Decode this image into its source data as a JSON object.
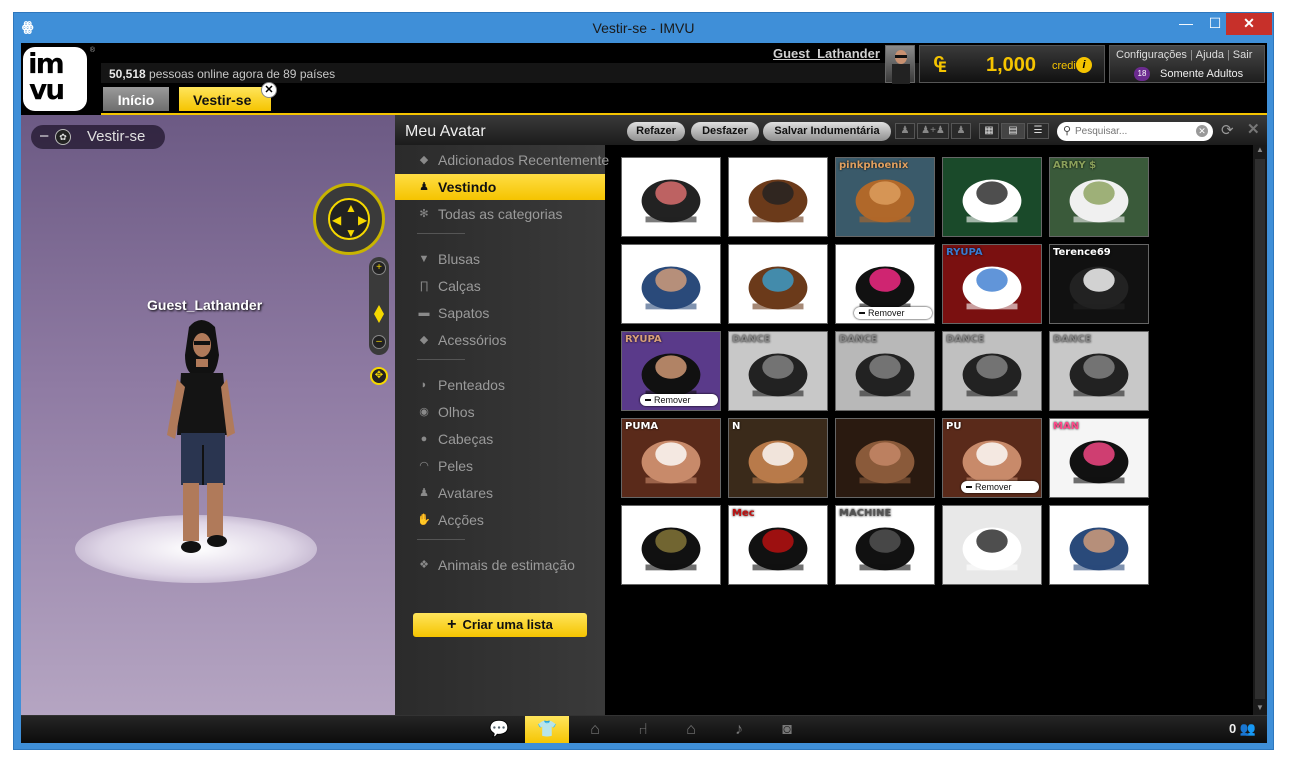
{
  "window": {
    "title": "Vestir-se - IMVU"
  },
  "header": {
    "online_count": "50,518",
    "online_text": " pessoas online agora de 89 países",
    "username": "Guest_Lathander",
    "credits_value": "1,000",
    "credits_label": "credits",
    "links": [
      "Configurações",
      "Ajuda",
      "Sair"
    ],
    "age_badge": "18",
    "age_filter": "Somente Adultos"
  },
  "tabs": [
    {
      "label": "Início"
    },
    {
      "label": "Vestir-se"
    }
  ],
  "viewport": {
    "tab_label": "Vestir-se",
    "avatar_name": "Guest_Lathander"
  },
  "panel": {
    "title": "Meu Avatar",
    "redo": "Refazer",
    "undo": "Desfazer",
    "save_outfit": "Salvar Indumentária",
    "search_placeholder": "Pesquisar..."
  },
  "sidebar": {
    "items": [
      {
        "label": "Adicionados Recentemente",
        "icon": "tag-icon"
      },
      {
        "label": "Vestindo",
        "icon": "person-icon"
      },
      {
        "label": "Todas as categorias",
        "icon": "asterisk-icon"
      },
      {
        "label": "Blusas",
        "icon": "shirt-icon"
      },
      {
        "label": "Calças",
        "icon": "pants-icon"
      },
      {
        "label": "Sapatos",
        "icon": "shoe-icon"
      },
      {
        "label": "Acessórios",
        "icon": "diamond-icon"
      },
      {
        "label": "Penteados",
        "icon": "hair-icon"
      },
      {
        "label": "Olhos",
        "icon": "eye-icon"
      },
      {
        "label": "Cabeças",
        "icon": "head-icon"
      },
      {
        "label": "Peles",
        "icon": "lips-icon"
      },
      {
        "label": "Avatares",
        "icon": "avatar-icon"
      },
      {
        "label": "Acções",
        "icon": "action-icon"
      },
      {
        "label": "Animais de estimação",
        "icon": "paw-icon"
      }
    ],
    "create_list": "Criar uma lista"
  },
  "grid": {
    "remove_label": "Remover",
    "items": [
      {
        "name": "top-hat",
        "bg": "#ffffff",
        "fg": "#222222",
        "accent": "#e57373",
        "caption": ""
      },
      {
        "name": "beanie-head",
        "bg": "#ffffff",
        "fg": "#6b3a1a",
        "accent": "#222222",
        "caption": ""
      },
      {
        "name": "spiky-hair",
        "bg": "#3a5a6a",
        "fg": "#b0682a",
        "accent": "#e0a060",
        "caption": "pinkphoenix"
      },
      {
        "name": "white-jacket",
        "bg": "#1a4a2a",
        "fg": "#ffffff",
        "accent": "#222222",
        "caption": ""
      },
      {
        "name": "army-sneakers",
        "bg": "#3a5a3a",
        "fg": "#f0f0f0",
        "accent": "#8aa05a",
        "caption": "ARMY $"
      },
      {
        "name": "jeans",
        "bg": "#ffffff",
        "fg": "#2a4a7a",
        "accent": "#d9a07a",
        "caption": ""
      },
      {
        "name": "headphones-head",
        "bg": "#ffffff",
        "fg": "#6b3a1a",
        "accent": "#3aa0d0",
        "caption": ""
      },
      {
        "name": "sunglasses",
        "bg": "#ffffff",
        "fg": "#111111",
        "accent": "#ff2a8a",
        "caption": ""
      },
      {
        "name": "red-sneaker",
        "bg": "#7a1010",
        "fg": "#ffffff",
        "accent": "#3a7ad0",
        "caption": "RYUPA"
      },
      {
        "name": "black-pants",
        "bg": "#111111",
        "fg": "#222222",
        "accent": "#ffffff",
        "caption": "Terence69"
      },
      {
        "name": "black-shirt",
        "bg": "#5a3a8a",
        "fg": "#111111",
        "accent": "#d9a07a",
        "caption": "RYUPA"
      },
      {
        "name": "dance-up",
        "bg": "#c8c8c8",
        "fg": "#222222",
        "accent": "#888888",
        "caption": "DANCE"
      },
      {
        "name": "dance-br",
        "bg": "#b8b8b8",
        "fg": "#222222",
        "accent": "#888888",
        "caption": "DANCE"
      },
      {
        "name": "dance-str",
        "bg": "#c0c0c0",
        "fg": "#222222",
        "accent": "#888888",
        "caption": "DANCE"
      },
      {
        "name": "dance-club",
        "bg": "#c8c8c8",
        "fg": "#222222",
        "accent": "#888888",
        "caption": "DANCE"
      },
      {
        "name": "face-puma",
        "bg": "#5a2a1a",
        "fg": "#c88a6a",
        "accent": "#ffffff",
        "caption": "PUMA"
      },
      {
        "name": "face-n",
        "bg": "#3a2a1a",
        "fg": "#b87a4a",
        "accent": "#ffffff",
        "caption": "N"
      },
      {
        "name": "abs-skin",
        "bg": "#2a1a10",
        "fg": "#8a5a3a",
        "accent": "#c88a6a",
        "caption": ""
      },
      {
        "name": "face-puma-2",
        "bg": "#5a2a1a",
        "fg": "#c88a6a",
        "accent": "#ffffff",
        "caption": "PU"
      },
      {
        "name": "black-boots",
        "bg": "#f5f5f5",
        "fg": "#111111",
        "accent": "#ff4a8a",
        "caption": "MAN"
      },
      {
        "name": "buckle-boots",
        "bg": "#ffffff",
        "fg": "#111111",
        "accent": "#8a7a3a",
        "caption": ""
      },
      {
        "name": "dress-shoes",
        "bg": "#ffffff",
        "fg": "#111111",
        "accent": "#c01010",
        "caption": "Mec"
      },
      {
        "name": "machine-boots",
        "bg": "#ffffff",
        "fg": "#111111",
        "accent": "#555555",
        "caption": "MACHINE"
      },
      {
        "name": "white-hightop",
        "bg": "#e8e8e8",
        "fg": "#ffffff",
        "accent": "#222222",
        "caption": ""
      },
      {
        "name": "jeans-sandals",
        "bg": "#ffffff",
        "fg": "#2a4a7a",
        "accent": "#d9a07a",
        "caption": ""
      }
    ],
    "removable": [
      7,
      10,
      18
    ]
  },
  "bottom_bar": {
    "buttons": [
      "chat-icon",
      "shirt-icon",
      "hanger-icon",
      "chair-icon",
      "home-icon",
      "music-icon",
      "camera-icon"
    ],
    "active_index": 1,
    "people_count": "0"
  },
  "colors": {
    "accent": "#f5c400",
    "window_frame": "#3f8fd8",
    "close": "#c7302a"
  }
}
